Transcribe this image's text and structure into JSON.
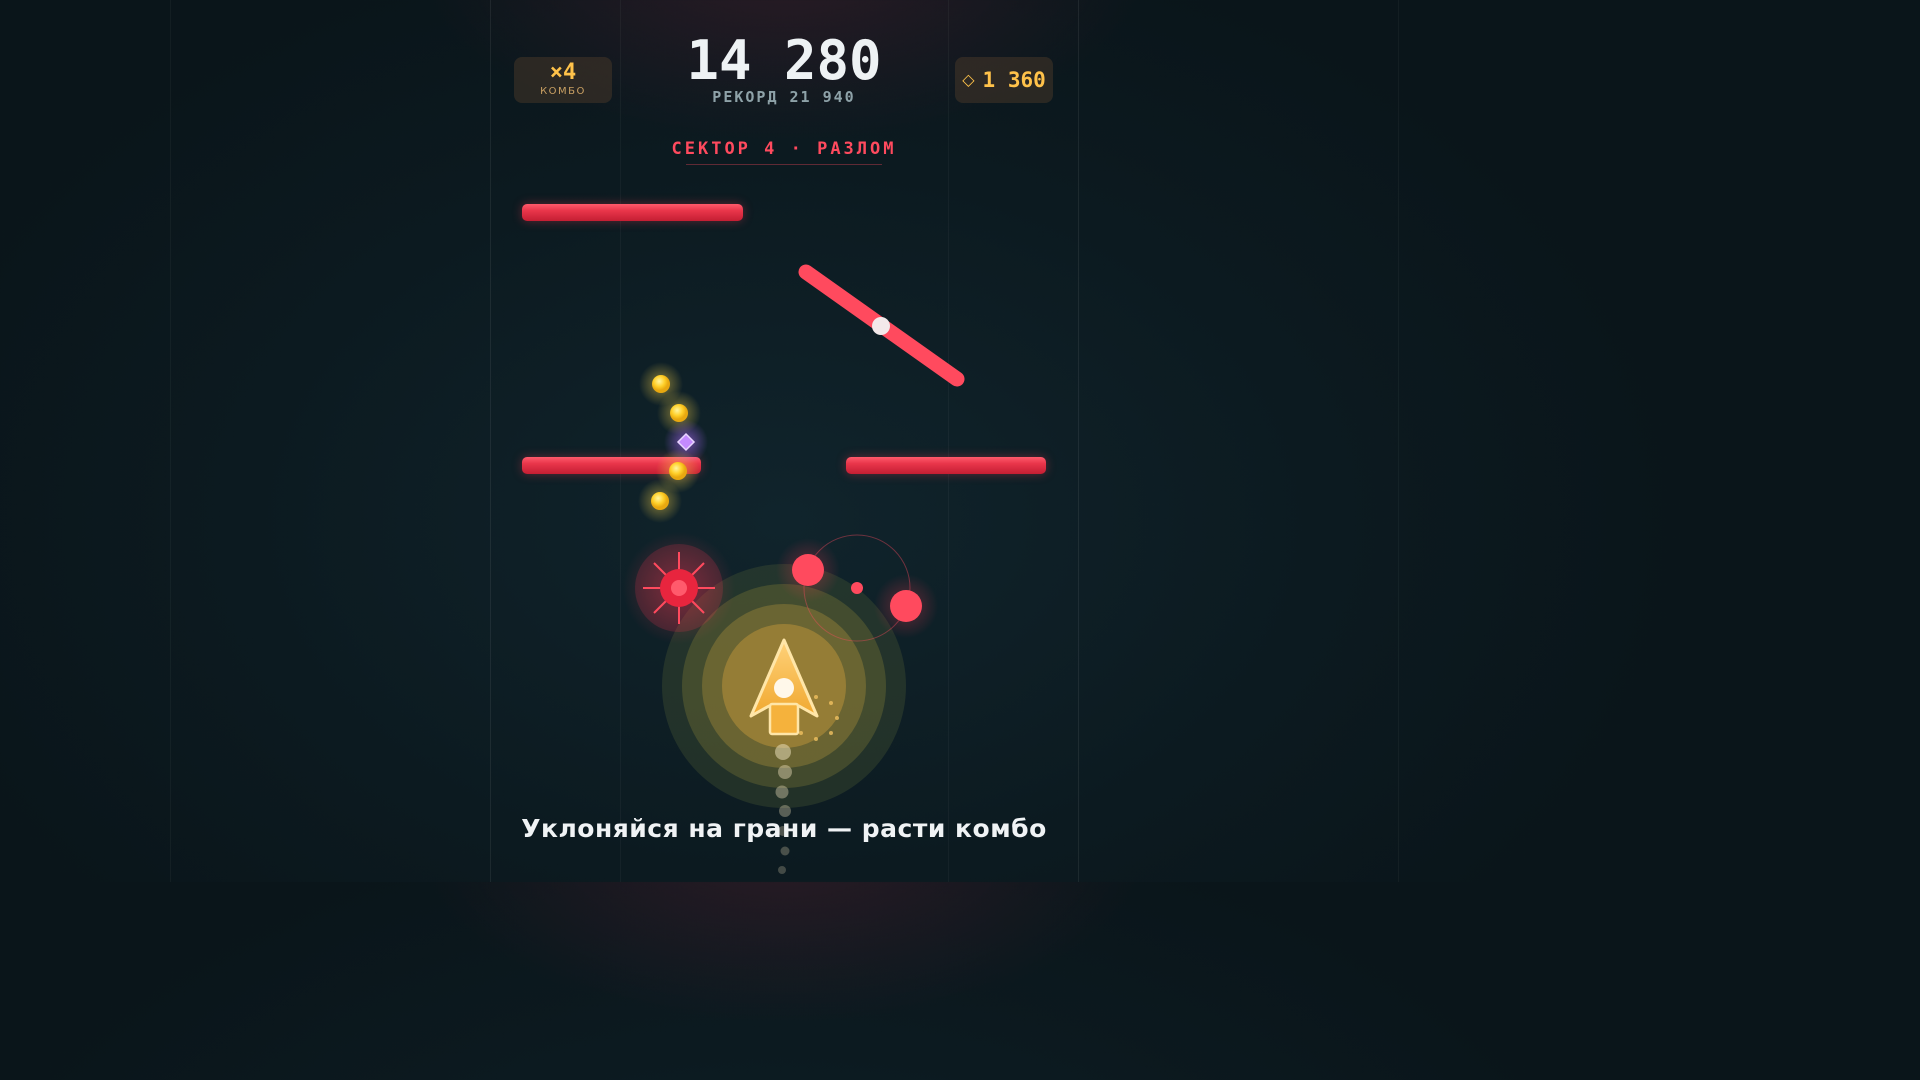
{
  "hud": {
    "combo": {
      "multiplier": "×4",
      "label": "КОМБО"
    },
    "score": "14 280",
    "record": "РЕКОРД 21 940",
    "gems": {
      "icon": "diamond-outline-icon",
      "amount": "1 360"
    }
  },
  "sector_banner": "СЕКТОР 4 · РАЗЛОМ",
  "hint": "Уклоняйся на грани — расти комбо",
  "colors": {
    "hazard": "#ff4a5e",
    "accent_gold": "#ffc24a",
    "gem_purple": "#b06bff",
    "background": "#0c1a20"
  },
  "objects": {
    "walls": 3,
    "rotating_bar": 1,
    "coins": 4,
    "gems": 1,
    "spike_mine": 1,
    "orbiting_orbs": 2,
    "player_ship": "arrow-ship-icon"
  }
}
